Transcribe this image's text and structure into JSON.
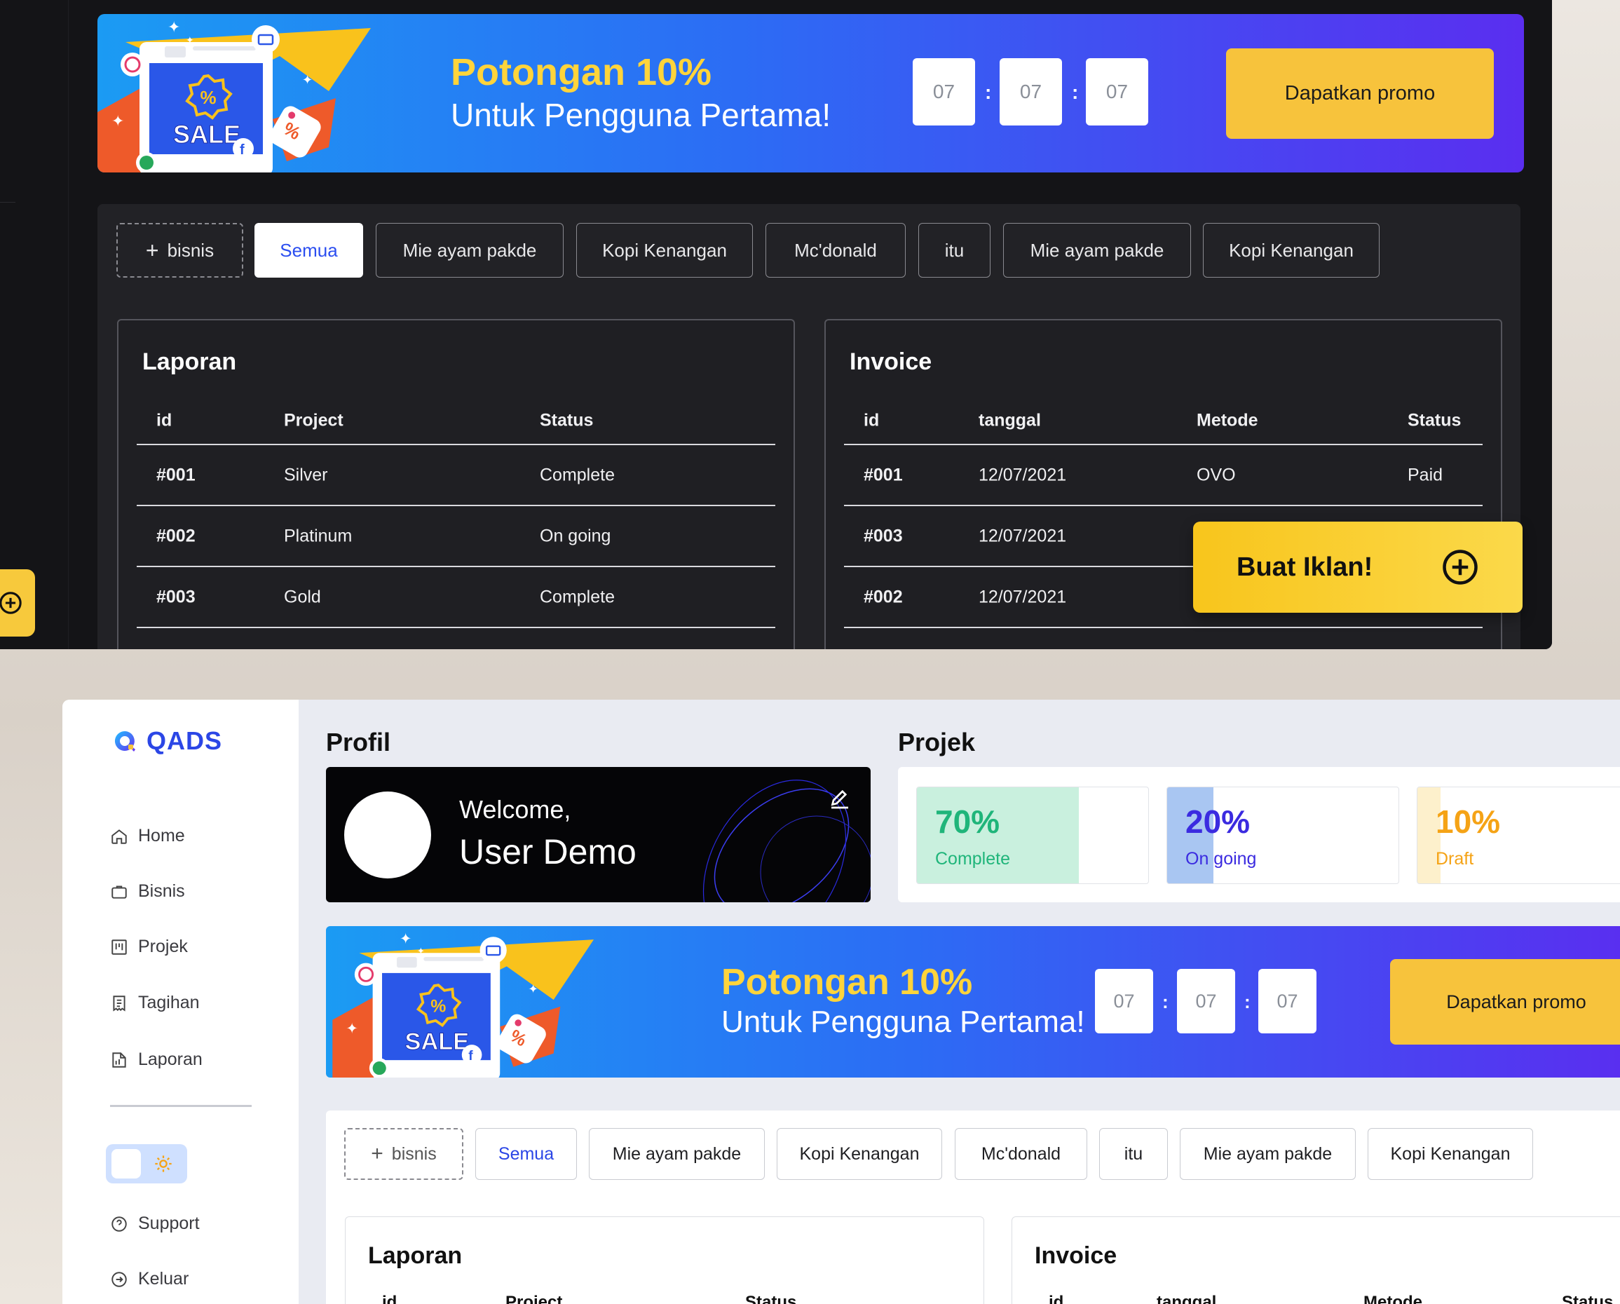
{
  "promo": {
    "title_line1": "Potongan 10%",
    "title_line2": "Untuk Pengguna Pertama!",
    "sale_art_text": "SALE",
    "timer": [
      "07",
      "07",
      "07"
    ],
    "timer_separator": ":",
    "button_label": "Dapatkan promo"
  },
  "filters": {
    "add_label": "bisnis",
    "add_icon": "plus-icon",
    "chips": [
      "Semua",
      "Mie ayam pakde",
      "Kopi Kenangan",
      "Mc'donald",
      "itu",
      "Mie ayam pakde",
      "Kopi Kenangan"
    ],
    "active": "Semua"
  },
  "laporan": {
    "title": "Laporan",
    "columns": [
      "id",
      "Project",
      "Status"
    ],
    "rows": [
      {
        "id": "#001",
        "project": "Silver",
        "status": "Complete"
      },
      {
        "id": "#002",
        "project": "Platinum",
        "status": "On going"
      },
      {
        "id": "#003",
        "project": "Gold",
        "status": "Complete"
      }
    ]
  },
  "invoice": {
    "title": "Invoice",
    "columns": [
      "id",
      "tanggal",
      "Metode",
      "Status"
    ],
    "rows": [
      {
        "id": "#001",
        "tanggal": "12/07/2021",
        "metode": "OVO",
        "status": "Paid"
      },
      {
        "id": "#003",
        "tanggal": "12/07/2021",
        "metode": "",
        "status": ""
      },
      {
        "id": "#002",
        "tanggal": "12/07/2021",
        "metode": "",
        "status": ""
      }
    ]
  },
  "fab": {
    "label": "Buat Iklan!",
    "icon": "plus-circle-icon"
  },
  "sidebar": {
    "logo": "QADS",
    "items": [
      {
        "label": "Home",
        "icon": "home-icon"
      },
      {
        "label": "Bisnis",
        "icon": "briefcase-icon"
      },
      {
        "label": "Projek",
        "icon": "kanban-icon"
      },
      {
        "label": "Tagihan",
        "icon": "receipt-icon"
      },
      {
        "label": "Laporan",
        "icon": "report-icon"
      }
    ],
    "bottom_items": [
      {
        "label": "Support",
        "icon": "help-circle-icon"
      },
      {
        "label": "Keluar",
        "icon": "logout-icon"
      }
    ],
    "theme_icon": "sun-icon"
  },
  "profil": {
    "section_title": "Profil",
    "welcome": "Welcome,",
    "name": "User Demo",
    "edit_icon": "edit-pen-icon"
  },
  "projek": {
    "section_title": "Projek",
    "stats": [
      {
        "pct": "70%",
        "label": "Complete",
        "fill": 0.7,
        "color": "#1fb57a",
        "bg": "#c9f0de"
      },
      {
        "pct": "20%",
        "label": "On going",
        "fill": 0.2,
        "color": "#3b2be0",
        "bg": "#a9c6f2"
      },
      {
        "pct": "10%",
        "label": "Draft",
        "fill": 0.1,
        "color": "#f5a316",
        "bg": "#fdf0cc"
      }
    ]
  },
  "colors": {
    "accent_blue": "#2b46e6",
    "accent_yellow": "#f7c33c",
    "dark_bg": "#141417"
  }
}
